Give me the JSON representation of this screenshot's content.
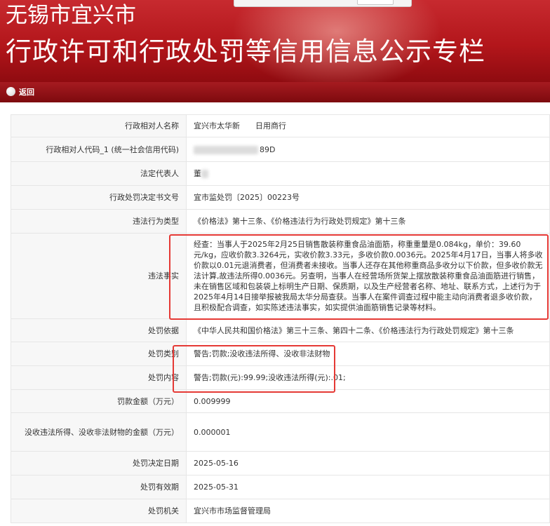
{
  "banner": {
    "city": "无锡市宜兴市",
    "title": "行政许可和行政处罚等信用信息公示专栏"
  },
  "nav": {
    "back_label": "返回"
  },
  "rows": [
    {
      "label": "行政相对人名称",
      "value": "宜兴市太华新　　日用商行"
    },
    {
      "label": "行政相对人代码_1 (统一社会信用代码)",
      "value": "89D"
    },
    {
      "label": "法定代表人",
      "value": "董"
    },
    {
      "label": "行政处罚决定书文号",
      "value": "宜市监处罚〔2025〕00223号"
    },
    {
      "label": "违法行为类型",
      "value": "《价格法》第十三条、《价格违法行为行政处罚规定》第十三条"
    },
    {
      "label": "违法事实",
      "value": "经查：当事人于2025年2月25日销售散装称重食品油面筋，称重重量是0.084kg，单价：39.60元/kg，应收价款3.3264元，实收价款3.33元，多收价款0.0036元。2025年4月17日，当事人将多收价款以0.01元退消费者，但消费者未接收。当事人还存在其他称重商品多收分以下价款，但多收价款无法计算,故违法所得0.0036元。另查明，当事人在经营场所货架上摆放散装称重食品油面筋进行销售，未在销售区域和包装袋上标明生产日期、保质期，以及生产经营者名称、地址、联系方式，上述行为于2025年4月14日接举报被我局太华分局查获。当事人在案件调查过程中能主动向消费者退多收价款，且积极配合调查，如实陈述违法事实，如实提供油面筋销售记录等材料。"
    },
    {
      "label": "处罚依据",
      "value": "《中华人民共和国价格法》第三十三条、第四十二条、《价格违法行为行政处罚规定》第十三条"
    },
    {
      "label": "处罚类别",
      "value": "警告;罚款;没收违法所得、没收非法财物"
    },
    {
      "label": "处罚内容",
      "value": "警告;罚款(元):99.99;没收违法所得(元):.01;"
    },
    {
      "label": "罚款金额（万元）",
      "value": "0.009999"
    },
    {
      "label": "没收违法所得、没收非法财物的金额（万元）",
      "value": "0.000001"
    },
    {
      "label": "处罚决定日期",
      "value": "2025-05-16"
    },
    {
      "label": "处罚有效期",
      "value": "2025-05-31"
    },
    {
      "label": "处罚机关",
      "value": "宜兴市市场监督管理局"
    }
  ],
  "colors": {
    "banner_red": "#b3161b",
    "nav_red": "#7d0a0e",
    "highlight": "#e53935",
    "label_bg": "#f7f7f7",
    "border": "#e6e6e6"
  }
}
